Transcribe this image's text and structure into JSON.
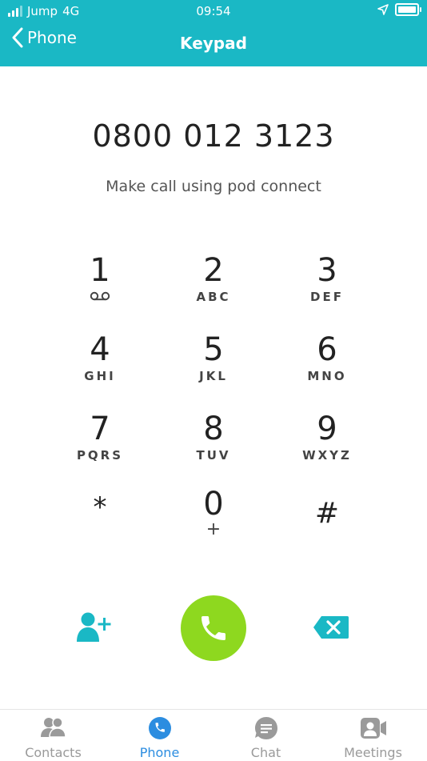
{
  "status_bar": {
    "carrier": "Jump",
    "network": "4G",
    "time": "09:54"
  },
  "nav": {
    "back_label": "Phone",
    "title": "Keypad"
  },
  "dialer": {
    "number": "0800 012 3123",
    "subtitle": "Make call using pod connect"
  },
  "keys": [
    {
      "digit": "1",
      "letters": ""
    },
    {
      "digit": "2",
      "letters": "ABC"
    },
    {
      "digit": "3",
      "letters": "DEF"
    },
    {
      "digit": "4",
      "letters": "GHI"
    },
    {
      "digit": "5",
      "letters": "JKL"
    },
    {
      "digit": "6",
      "letters": "MNO"
    },
    {
      "digit": "7",
      "letters": "PQRS"
    },
    {
      "digit": "8",
      "letters": "TUV"
    },
    {
      "digit": "9",
      "letters": "WXYZ"
    },
    {
      "digit": "*",
      "letters": ""
    },
    {
      "digit": "0",
      "letters": "+"
    },
    {
      "digit": "#",
      "letters": ""
    }
  ],
  "tabs": [
    {
      "label": "Contacts",
      "icon": "contacts-icon"
    },
    {
      "label": "Phone",
      "icon": "phone-icon"
    },
    {
      "label": "Chat",
      "icon": "chat-icon"
    },
    {
      "label": "Meetings",
      "icon": "meetings-icon"
    }
  ],
  "colors": {
    "header": "#1ab8c5",
    "call_button": "#8ed81f",
    "accent": "#1ab8c5",
    "active_tab": "#2c8de0",
    "inactive_tab": "#9a9a9a"
  }
}
